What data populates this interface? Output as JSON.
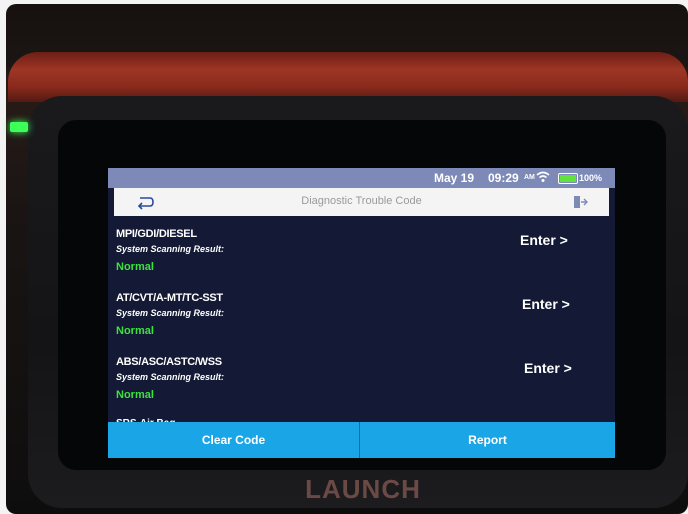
{
  "device": {
    "brand": "LAUNCH"
  },
  "status_bar": {
    "date": "May 19",
    "time": "09:29",
    "ampm": "AM",
    "battery": "100%"
  },
  "header": {
    "title": "Diagnostic Trouble Code"
  },
  "scan_label": "System Scanning Result:",
  "enter_label": "Enter >",
  "systems": [
    {
      "name": "MPI/GDI/DIESEL",
      "status": "Normal"
    },
    {
      "name": "AT/CVT/A-MT/TC-SST",
      "status": "Normal"
    },
    {
      "name": "ABS/ASC/ASTC/WSS",
      "status": "Normal"
    }
  ],
  "partial_system": "SRS-Air Bag",
  "buttons": {
    "clear_code": "Clear Code",
    "report": "Report"
  },
  "colors": {
    "ok_status": "#3ee23e",
    "action_bar": "#1aa6e6",
    "screen_bg": "#141a35"
  }
}
